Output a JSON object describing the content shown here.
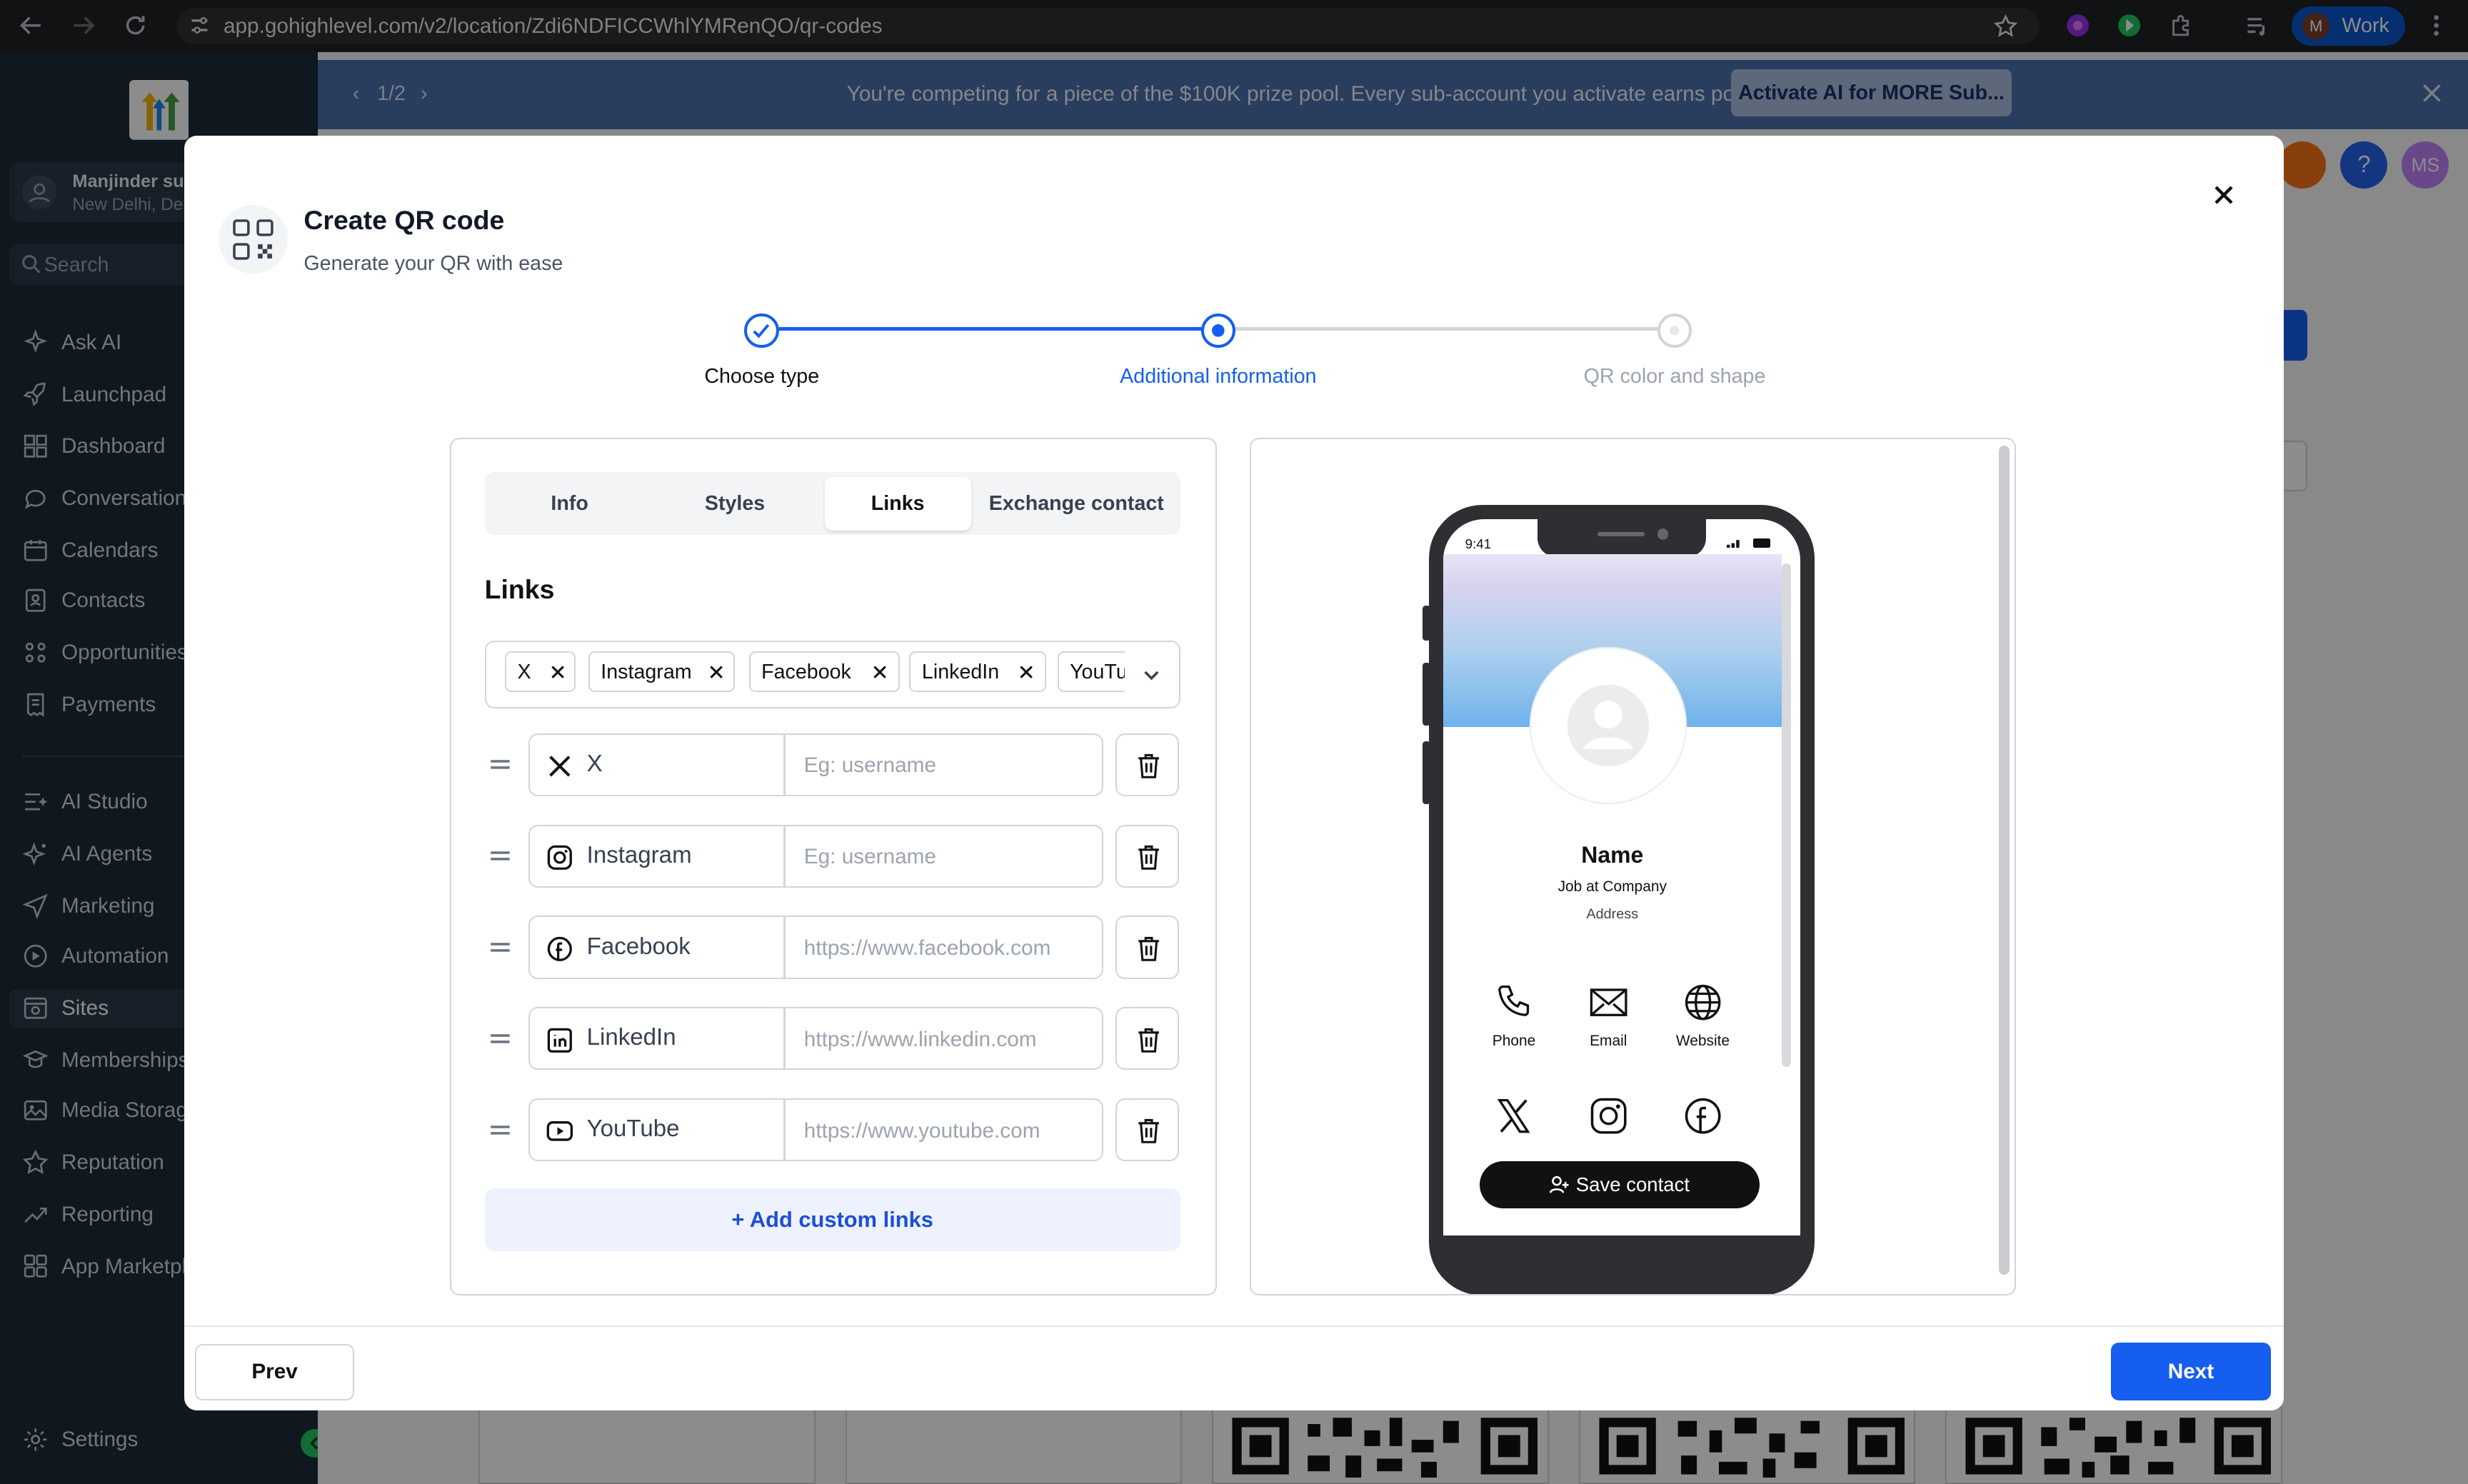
{
  "browser": {
    "url": "app.gohighlevel.com/v2/location/Zdi6NDFICCWhlYMRenQO/qr-codes",
    "profile_label": "Work",
    "profile_initial": "M"
  },
  "sidebar": {
    "account_name": "Manjinder suba",
    "account_location": "New Delhi, Delhi",
    "search_placeholder": "Search",
    "items": [
      {
        "label": "Ask AI",
        "icon": "sparkle-icon"
      },
      {
        "label": "Launchpad",
        "icon": "rocket-icon"
      },
      {
        "label": "Dashboard",
        "icon": "dashboard-grid-icon"
      },
      {
        "label": "Conversations",
        "icon": "chat-bubble-icon"
      },
      {
        "label": "Calendars",
        "icon": "calendar-icon"
      },
      {
        "label": "Contacts",
        "icon": "contacts-icon"
      },
      {
        "label": "Opportunities",
        "icon": "opportunities-icon"
      },
      {
        "label": "Payments",
        "icon": "payments-icon"
      },
      {
        "label": "AI Studio",
        "icon": "ai-studio-icon"
      },
      {
        "label": "AI Agents",
        "icon": "ai-agents-icon"
      },
      {
        "label": "Marketing",
        "icon": "send-icon"
      },
      {
        "label": "Automation",
        "icon": "automation-icon"
      },
      {
        "label": "Sites",
        "icon": "sites-icon"
      },
      {
        "label": "Memberships",
        "icon": "memberships-icon"
      },
      {
        "label": "Media Storage",
        "icon": "image-icon"
      },
      {
        "label": "Reputation",
        "icon": "star-icon"
      },
      {
        "label": "Reporting",
        "icon": "trend-icon"
      },
      {
        "label": "App Marketplace",
        "icon": "apps-grid-icon"
      }
    ],
    "settings_label": "Settings"
  },
  "banner": {
    "pager": "1/2",
    "message": "You're competing for a piece of the $100K prize pool. Every sub-account you activate earns points.",
    "cta": "Activate AI for MORE Sub..."
  },
  "header": {
    "avatar_initials": "MS"
  },
  "modal": {
    "title": "Create QR code",
    "subtitle": "Generate your QR with ease",
    "steps": [
      {
        "label": "Choose type",
        "state": "done"
      },
      {
        "label": "Additional information",
        "state": "current"
      },
      {
        "label": "QR color and shape",
        "state": "pending"
      }
    ],
    "tabs": [
      "Info",
      "Styles",
      "Links",
      "Exchange contact"
    ],
    "active_tab": "Links",
    "section_title": "Links",
    "selected_chips": [
      "X",
      "Instagram",
      "Facebook",
      "LinkedIn",
      "YouTu"
    ],
    "link_rows": [
      {
        "platform": "X",
        "placeholder": "Eg: username",
        "icon": "x-logo-icon"
      },
      {
        "platform": "Instagram",
        "placeholder": "Eg: username",
        "icon": "instagram-icon"
      },
      {
        "platform": "Facebook",
        "placeholder": "https://www.facebook.com",
        "icon": "facebook-icon"
      },
      {
        "platform": "LinkedIn",
        "placeholder": "https://www.linkedin.com",
        "icon": "linkedin-icon"
      },
      {
        "platform": "YouTube",
        "placeholder": "https://www.youtube.com",
        "icon": "youtube-icon"
      }
    ],
    "add_custom_label": "+ Add custom links",
    "prev_label": "Prev",
    "next_label": "Next"
  },
  "preview": {
    "time": "9:41",
    "name": "Name",
    "job": "Job at Company",
    "address": "Address",
    "contact_actions": [
      {
        "label": "Phone",
        "icon": "phone-icon"
      },
      {
        "label": "Email",
        "icon": "email-icon"
      },
      {
        "label": "Website",
        "icon": "globe-icon"
      }
    ],
    "social_icons": [
      "x-logo-icon",
      "instagram-icon",
      "facebook-icon"
    ],
    "save_label": "Save contact"
  },
  "colors": {
    "primary": "#155eef",
    "sidebar_bg": "#1d2b3a",
    "banner_bg": "#4b6fad"
  }
}
